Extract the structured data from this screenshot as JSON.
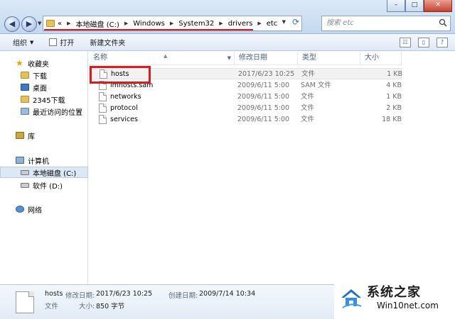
{
  "window": {
    "controls": {
      "minimize": "–",
      "maximize": "□",
      "close": "✕"
    }
  },
  "address": {
    "prefix": "«",
    "parts": [
      "本地磁盘 (C:)",
      "Windows",
      "System32",
      "drivers",
      "etc"
    ],
    "refresh_icon": "refresh-icon"
  },
  "search": {
    "placeholder": "搜索 etc"
  },
  "toolbar": {
    "organize": "组织",
    "open": "打开",
    "new_folder": "新建文件夹"
  },
  "sidebar": {
    "favorites": "收藏夹",
    "downloads": "下载",
    "desktop": "桌面",
    "downloads2345": "2345下载",
    "recent": "最近访问的位置",
    "libraries": "库",
    "computer": "计算机",
    "local_disk": "本地磁盘 (C:)",
    "software_d": "软件 (D:)",
    "network": "网络"
  },
  "columns": {
    "name": "名称",
    "date": "修改日期",
    "type": "类型",
    "size": "大小"
  },
  "files": [
    {
      "name": "hosts",
      "date": "2017/6/23 10:25",
      "type": "文件",
      "size": "1 KB"
    },
    {
      "name": "lmhosts.sam",
      "date": "2009/6/11 5:00",
      "type": "SAM 文件",
      "size": "4 KB"
    },
    {
      "name": "networks",
      "date": "2009/6/11 5:00",
      "type": "文件",
      "size": "1 KB"
    },
    {
      "name": "protocol",
      "date": "2009/6/11 5:00",
      "type": "文件",
      "size": "2 KB"
    },
    {
      "name": "services",
      "date": "2009/6/11 5:00",
      "type": "文件",
      "size": "18 KB"
    }
  ],
  "details": {
    "name": "hosts",
    "modified_label": "修改日期:",
    "modified": "2017/6/23 10:25",
    "created_label": "创建日期:",
    "created": "2009/7/14 10:34",
    "type": "文件",
    "size_label": "大小:",
    "size": "850 字节"
  },
  "watermark": {
    "title": "系统之家",
    "subtitle": "Win10net.com"
  },
  "colors": {
    "highlight_red": "#d61e1e",
    "accent_blue": "#3a6db0"
  }
}
